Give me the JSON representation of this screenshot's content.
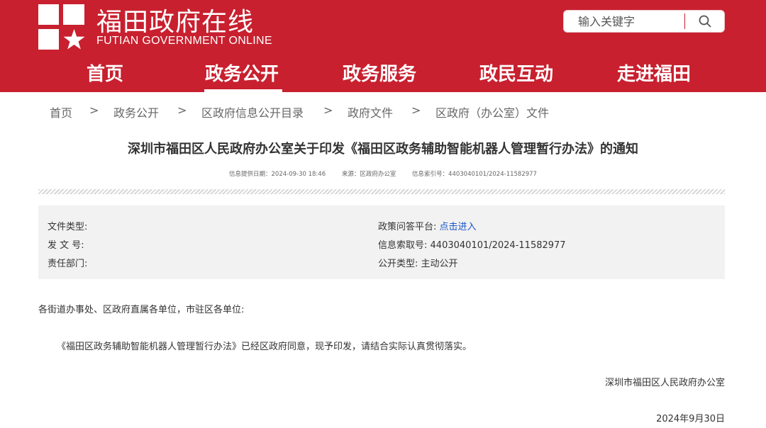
{
  "header": {
    "site_title": "福田政府在线",
    "site_subtitle": "FUTIAN GOVERNMENT ONLINE",
    "logo_icon": "futian-logo-icon",
    "brand_color": "#c8202f"
  },
  "search": {
    "placeholder": "输入关键字",
    "button_icon": "search-icon"
  },
  "nav": {
    "items": [
      {
        "label": "首页"
      },
      {
        "label": "政务公开"
      },
      {
        "label": "政务服务"
      },
      {
        "label": "政民互动"
      },
      {
        "label": "走进福田"
      }
    ],
    "active": "政务公开"
  },
  "breadcrumb": {
    "items": [
      "首页",
      "政务公开",
      "区政府信息公开目录",
      "政府文件",
      "区政府（办公室）文件"
    ],
    "separator": ">"
  },
  "document": {
    "title": "深圳市福田区人民政府办公室关于印发《福田区政务辅助智能机器人管理暂行办法》的通知",
    "meta_date": "信息提供日期：2024-09-30 18:46",
    "meta_source": "来源：区政府办公室",
    "meta_index": "信息索引号：4403040101/2024-11582977"
  },
  "info": {
    "file_type_label": "文件类型:",
    "doc_number_label": "发 文 号:",
    "department_label": "责任部门:",
    "qa_platform_label": "政策问答平台:",
    "qa_platform_link": "点击进入",
    "index_label": "信息索取号:",
    "index_value": "4403040101/2024-11582977",
    "public_type_label": "公开类型:",
    "public_type_value": "主动公开",
    "link_color": "#1a55c8"
  },
  "body": {
    "salutation": "各街道办事处、区政府直属各单位，市驻区各单位:",
    "paragraph": "《福田区政务辅助智能机器人管理暂行办法》已经区政府同意，现予印发，请结合实际认真贯彻落实。",
    "signature": "深圳市福田区人民政府办公室",
    "date": "2024年9月30日"
  }
}
